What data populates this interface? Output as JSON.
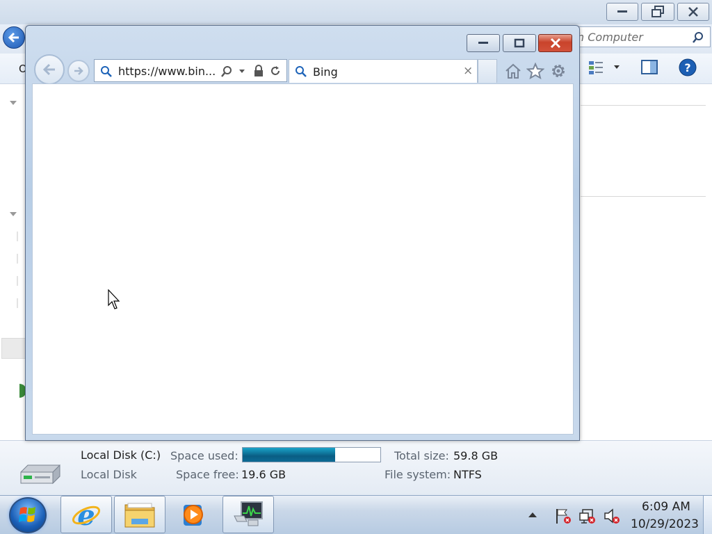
{
  "explorer": {
    "search_placeholder": "h Computer",
    "toolbar_fragment": "O",
    "details": {
      "drive_name": "Local Disk (C:)",
      "drive_type": "Local Disk",
      "space_used_label": "Space used:",
      "space_used_fraction": 0.67,
      "space_free_label": "Space free:",
      "space_free_value": "19.6 GB",
      "total_size_label": "Total size:",
      "total_size_value": "59.8 GB",
      "file_system_label": "File system:",
      "file_system_value": "NTFS"
    }
  },
  "ie": {
    "address": "https://www.bin...",
    "tab_title": "Bing",
    "tab_close": "×"
  },
  "taskbar": {
    "buttons": [
      "internet-explorer",
      "windows-explorer",
      "windows-media-player",
      "task-manager"
    ],
    "clock_time": "6:09 AM",
    "clock_date": "10/29/2023"
  },
  "colors": {
    "ie_close": "#c9432b",
    "space_bar_fill": "#0a5d84",
    "taskbar": "#c9d7e8"
  }
}
